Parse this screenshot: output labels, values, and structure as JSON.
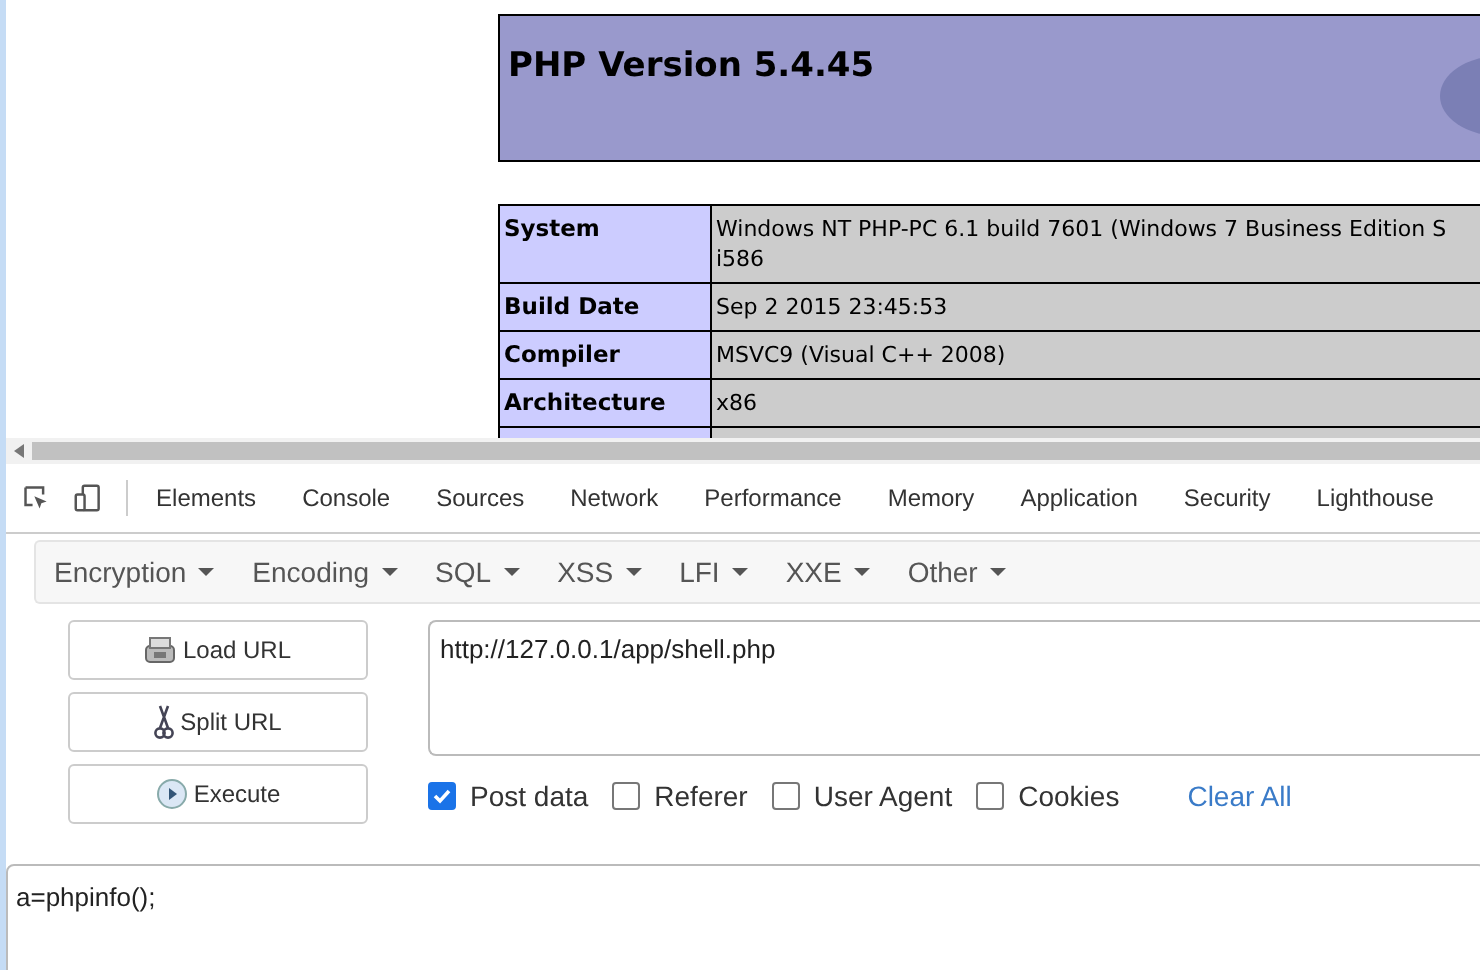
{
  "page": {
    "heading": "PHP Version 5.4.45",
    "info_rows": [
      {
        "label": "System",
        "lines": [
          "Windows NT PHP-PC 6.1 build 7601 (Windows 7 Business Edition S",
          "i586"
        ]
      },
      {
        "label": "Build Date",
        "lines": [
          "Sep 2 2015 23:45:53"
        ]
      },
      {
        "label": "Compiler",
        "lines": [
          "MSVC9 (Visual C++ 2008)"
        ]
      },
      {
        "label": "Architecture",
        "lines": [
          "x86"
        ]
      }
    ]
  },
  "devtools": {
    "tabs": [
      "Elements",
      "Console",
      "Sources",
      "Network",
      "Performance",
      "Memory",
      "Application",
      "Security",
      "Lighthouse"
    ]
  },
  "hackbar": {
    "menus": [
      "Encryption",
      "Encoding",
      "SQL",
      "XSS",
      "LFI",
      "XXE",
      "Other"
    ],
    "buttons": [
      {
        "kind": "load",
        "label": "Load URL"
      },
      {
        "kind": "split",
        "label": "Split URL"
      },
      {
        "kind": "execute",
        "label": "Execute"
      }
    ],
    "url": "http://127.0.0.1/app/shell.php",
    "options": [
      {
        "label": "Post data",
        "checked": true
      },
      {
        "label": "Referer",
        "checked": false
      },
      {
        "label": "User Agent",
        "checked": false
      },
      {
        "label": "Cookies",
        "checked": false
      }
    ],
    "clear": "Clear All",
    "post_data": "a=phpinfo();"
  }
}
